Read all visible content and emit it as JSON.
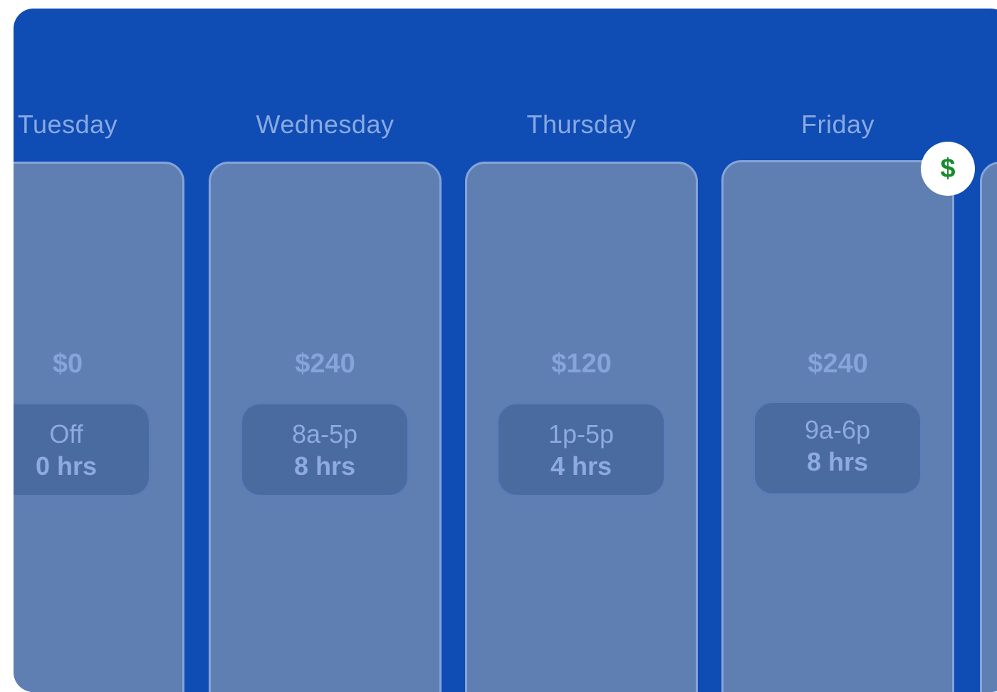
{
  "days": [
    {
      "name": "Tuesday",
      "amount": "$0",
      "shift_time": "Off",
      "shift_hours": "0 hrs"
    },
    {
      "name": "Wednesday",
      "amount": "$240",
      "shift_time": "8a-5p",
      "shift_hours": "8 hrs"
    },
    {
      "name": "Thursday",
      "amount": "$120",
      "shift_time": "1p-5p",
      "shift_hours": "4 hrs"
    },
    {
      "name": "Friday",
      "amount": "$240",
      "shift_time": "9a-6p",
      "shift_hours": "8 hrs"
    }
  ],
  "badge": {
    "symbol": "$",
    "icon": "dollar-icon"
  },
  "colors": {
    "panel_bg": "#0f4cb4",
    "card_bg": "#5f7fb2",
    "card_border": "#86a4da",
    "shift_bg": "#4a6ba0",
    "text_muted": "#8eaadf",
    "badge_dollar": "#178a2e"
  }
}
